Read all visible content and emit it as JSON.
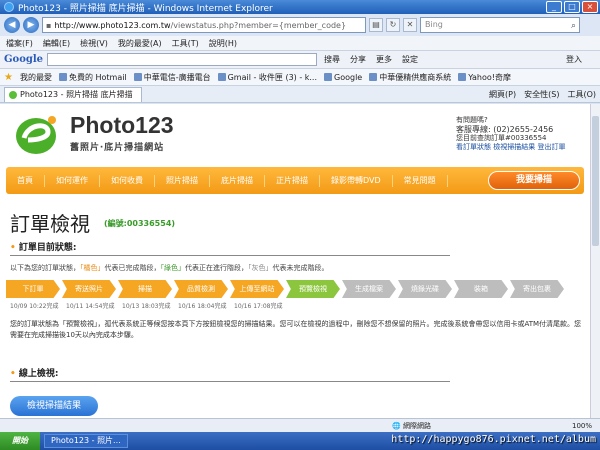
{
  "window": {
    "title": "Photo123 - 照片掃描 底片掃描 - Windows Internet Explorer"
  },
  "address": {
    "url_host": "http://www.photo123.com.tw",
    "url_rest": "/viewstatus.php?member={member_code}",
    "search_placeholder": "Bing"
  },
  "menu": [
    "檔案(F)",
    "編輯(E)",
    "檢視(V)",
    "我的最愛(A)",
    "工具(T)",
    "說明(H)"
  ],
  "google_toolbar": {
    "logo": "Google",
    "search_label": "搜尋",
    "share_label": "分享",
    "more_label": "更多",
    "settings_label": "設定",
    "login_label": "登入"
  },
  "favorites": {
    "label": "我的最愛",
    "items": [
      "免費的 Hotmail",
      "中華電信-廣播電台",
      "Gmail - 收件匣 (3) - k...",
      "Google",
      "中華優精供應商系統",
      "Yahoo!奇摩"
    ]
  },
  "tab": {
    "label": "Photo123 - 照片掃描 底片掃描",
    "commands": [
      "網頁(P)",
      "安全性(S)",
      "工具(O)"
    ]
  },
  "site": {
    "brand": "Photo123",
    "tagline": "舊照片‧底片掃描網站",
    "contact_q": "有問題嗎?",
    "phone": "客服專線: (02)2655-2456",
    "order_line": "您目前查詢訂單#00336554",
    "links": "看訂單狀態 檢視掃描結果 登出訂單"
  },
  "nav": {
    "items": [
      "首頁",
      "如何運作",
      "如何收費",
      "照片掃描",
      "底片掃描",
      "正片掃描",
      "錄影帶轉DVD",
      "常見問題"
    ],
    "cta": "我要掃描"
  },
  "order": {
    "title": "訂單檢視",
    "number": "(編號:00336554)",
    "status_heading": "訂單目前狀態:",
    "desc_prefix": "以下為您的訂單狀態，",
    "desc_orange": "「橘色」",
    "desc_mid1": "代表已完成階段，",
    "desc_green": "「綠色」",
    "desc_mid2": "代表正在進行階段，",
    "desc_grey": "「灰色」",
    "desc_suffix": "代表未完成階段。",
    "steps": [
      {
        "label": "下訂單",
        "state": "done"
      },
      {
        "label": "寄送照片",
        "state": "done"
      },
      {
        "label": "掃描",
        "state": "done"
      },
      {
        "label": "品質檢測",
        "state": "done"
      },
      {
        "label": "上傳至網站",
        "state": "done"
      },
      {
        "label": "預覽檢視",
        "state": "current"
      },
      {
        "label": "生成檔案",
        "state": "pending"
      },
      {
        "label": "燒錄光碟",
        "state": "pending"
      },
      {
        "label": "裝箱",
        "state": "pending"
      },
      {
        "label": "寄出包裹",
        "state": "pending"
      }
    ],
    "dates": [
      "10/09 10:22完成",
      "10/11 14:54完成",
      "10/13 18:03完成",
      "10/16 18:04完成",
      "10/16 17:08完成"
    ],
    "paragraph": "您的訂單狀態為「預覽檢視」，孤代表系統正等候您按本頁下方按鈕檢視您的掃描結果。您可以在檢視的過程中，刪除您不想保留的照片。完成後系統會帶您以信用卡或ATM付清尾款。您需要在完成掃描後10天以內完成本步驟。",
    "online_heading": "線上檢視:",
    "view_button": "檢視掃描結果"
  },
  "status_bar": {
    "zone": "網際網路",
    "zoom": "100%"
  },
  "taskbar": {
    "start": "開始",
    "tasks": [
      "Photo123 - 照片..."
    ]
  },
  "watermark": "http://happygo876.pixnet.net/album"
}
